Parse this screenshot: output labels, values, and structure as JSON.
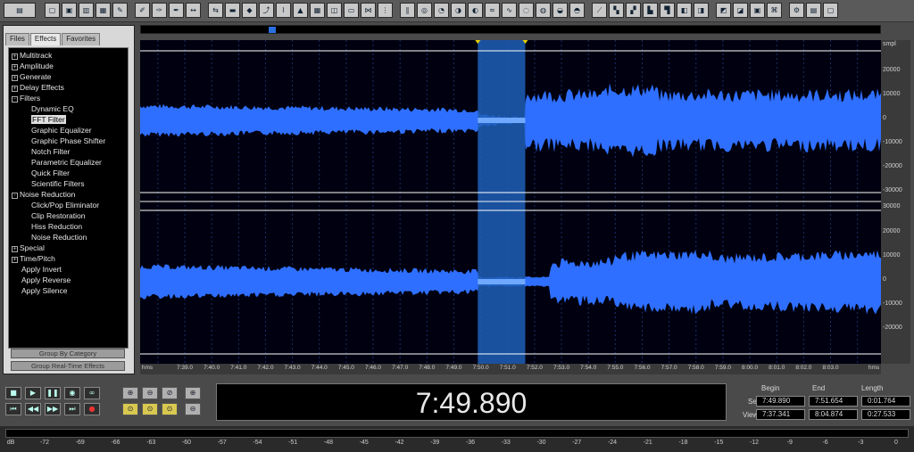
{
  "toolbar": {
    "icons": [
      "multitrack-view-icon",
      "new-file-icon",
      "open-file-icon",
      "save-icon",
      "save-as-icon",
      "close-file-icon",
      "edit-icon",
      "edit2-icon",
      "edit3-icon",
      "edit4-icon",
      "move-tool-icon",
      "mix-paste-icon",
      "silence-icon",
      "dc-offset-icon",
      "cursor-icon",
      "fade-icon",
      "amplify-icon",
      "generate-icon",
      "pan-icon",
      "envelope-icon",
      "expand-icon",
      "graphic-eq-icon",
      "noise-icon",
      "reverb-icon",
      "echo-icon",
      "delay-icon",
      "flanger-icon",
      "chorus-icon",
      "stretch-icon",
      "pitch-icon",
      "spectral-icon",
      "frequency-icon",
      "analysis-icon",
      "phase-icon",
      "statistics-icon",
      "cd-icon",
      "loop-icon",
      "marker-icon",
      "region-icon",
      "batch-icon",
      "script-icon",
      "cue-icon",
      "tool-icon",
      "spectrum-icon",
      "waveform-icon",
      "settings-icon"
    ]
  },
  "panel": {
    "tabs": [
      "Files",
      "Effects",
      "Favorites"
    ],
    "active_tab": "Effects",
    "tree": [
      {
        "label": "Multitrack",
        "level": 0,
        "expander": "+"
      },
      {
        "label": "Amplitude",
        "level": 0,
        "expander": "+"
      },
      {
        "label": "Generate",
        "level": 0,
        "expander": "+"
      },
      {
        "label": "Delay Effects",
        "level": 0,
        "expander": "+"
      },
      {
        "label": "Filters",
        "level": 0,
        "expander": "-"
      },
      {
        "label": "Dynamic EQ",
        "level": 1
      },
      {
        "label": "FFT Filter",
        "level": 1,
        "selected": true
      },
      {
        "label": "Graphic Equalizer",
        "level": 1
      },
      {
        "label": "Graphic Phase Shifter",
        "level": 1
      },
      {
        "label": "Notch Filter",
        "level": 1
      },
      {
        "label": "Parametric Equalizer",
        "level": 1
      },
      {
        "label": "Quick Filter",
        "level": 1
      },
      {
        "label": "Scientific Filters",
        "level": 1
      },
      {
        "label": "Noise Reduction",
        "level": 0,
        "expander": "-"
      },
      {
        "label": "Click/Pop Eliminator",
        "level": 1
      },
      {
        "label": "Clip Restoration",
        "level": 1
      },
      {
        "label": "Hiss Reduction",
        "level": 1
      },
      {
        "label": "Noise Reduction",
        "level": 1
      },
      {
        "label": "Special",
        "level": 0,
        "expander": "+"
      },
      {
        "label": "Time/Pitch",
        "level": 0,
        "expander": "+"
      },
      {
        "label": "Apply Invert",
        "level": 0
      },
      {
        "label": "Apply Reverse",
        "level": 0
      },
      {
        "label": "Apply Silence",
        "level": 0
      }
    ],
    "group_by_category": "Group By Category",
    "group_realtime": "Group Real-Time Effects"
  },
  "scale": {
    "unit": "smpl",
    "top_labels": [
      "20000",
      "10000",
      "0",
      "-10000",
      "-20000",
      "-30000"
    ],
    "bottom_labels": [
      "30000",
      "20000",
      "10000",
      "0",
      "-10000",
      "-20000"
    ]
  },
  "time_axis": {
    "unit_left": "hms",
    "unit_right": "hms",
    "ticks": [
      "7:39.0",
      "7:40.0",
      "7:41.0",
      "7:42.0",
      "7:43.0",
      "7:44.0",
      "7:45.0",
      "7:46.0",
      "7:47.0",
      "7:48.0",
      "7:49.0",
      "7:50.0",
      "7:51.0",
      "7:52.0",
      "7:53.0",
      "7:54.0",
      "7:55.0",
      "7:56.0",
      "7:57.0",
      "7:58.0",
      "7:59.0",
      "8:00.0",
      "8:01.0",
      "8:02.0",
      "8:03.0"
    ]
  },
  "waveform": {
    "view_begin_s": 457.341,
    "view_end_s": 484.874,
    "selection_begin_s": 469.89,
    "selection_end_s": 471.654,
    "wave_color": "#2f6fff",
    "selection_color": "#1e5fb8",
    "background": "#000010"
  },
  "current_time": "7:49.890",
  "selection": {
    "headers": [
      "Begin",
      "End",
      "Length"
    ],
    "rows": [
      {
        "label": "Sel",
        "begin": "7:49.890",
        "end": "7:51.654",
        "length": "0:01.764"
      },
      {
        "label": "View",
        "begin": "7:37.341",
        "end": "8:04.874",
        "length": "0:27.533"
      }
    ]
  },
  "meter": {
    "unit": "dB",
    "labels": [
      "-72",
      "-69",
      "-66",
      "-63",
      "-60",
      "-57",
      "-54",
      "-51",
      "-48",
      "-45",
      "-42",
      "-39",
      "-36",
      "-33",
      "-30",
      "-27",
      "-24",
      "-21",
      "-18",
      "-15",
      "-12",
      "-9",
      "-6",
      "-3",
      "0"
    ]
  },
  "transport": {
    "buttons": [
      "stop-button",
      "play-button",
      "pause-button",
      "play-to-end-button",
      "loop-button",
      "go-to-start-button",
      "rewind-button",
      "fast-forward-button",
      "go-to-end-button",
      "record-button"
    ]
  },
  "zoom": {
    "buttons": [
      "zoom-in-horizontal-button",
      "zoom-out-horizontal-button",
      "zoom-out-full-button",
      "zoom-in-vertical-button",
      "zoom-to-left-button",
      "zoom-to-right-button",
      "zoom-to-selection-button",
      "zoom-out-vertical-button"
    ]
  }
}
